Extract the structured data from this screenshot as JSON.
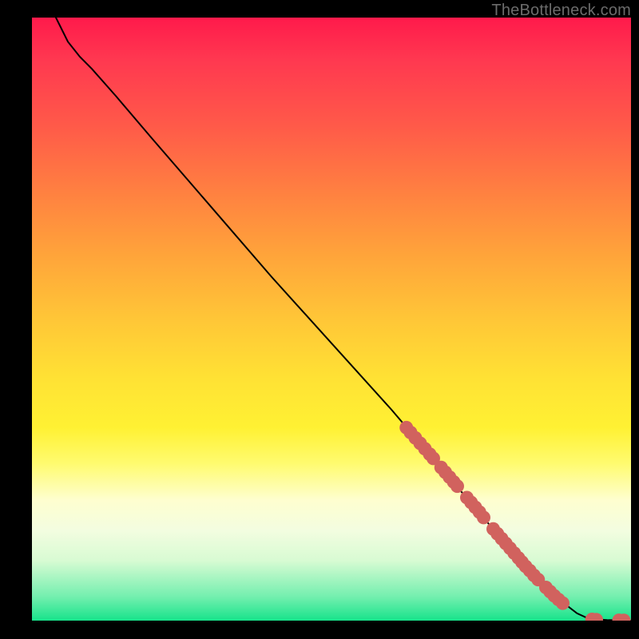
{
  "brand_label": "TheBottleneck.com",
  "colors": {
    "marker": "#d1625e",
    "curve": "#000000"
  },
  "chart_data": {
    "type": "line",
    "title": "",
    "xlabel": "",
    "ylabel": "",
    "xlim": [
      0,
      100
    ],
    "ylim": [
      0,
      100
    ],
    "grid": false,
    "legend": false,
    "notes": "Bottleneck-style curve: y drops from 100 at x≈4 to 0 near x≈93, then flat at 0. Markers cluster on the lower segment (roughly 62–100% x) where the curve approaches zero.",
    "curve": [
      {
        "x": 4,
        "y": 100
      },
      {
        "x": 6,
        "y": 96
      },
      {
        "x": 8,
        "y": 93.5
      },
      {
        "x": 10,
        "y": 91.5
      },
      {
        "x": 14,
        "y": 87
      },
      {
        "x": 20,
        "y": 80
      },
      {
        "x": 30,
        "y": 68.5
      },
      {
        "x": 40,
        "y": 57
      },
      {
        "x": 50,
        "y": 46
      },
      {
        "x": 60,
        "y": 35
      },
      {
        "x": 66,
        "y": 28
      },
      {
        "x": 72,
        "y": 21
      },
      {
        "x": 78,
        "y": 14
      },
      {
        "x": 84,
        "y": 7.5
      },
      {
        "x": 88,
        "y": 3.5
      },
      {
        "x": 91,
        "y": 1.2
      },
      {
        "x": 93,
        "y": 0.3
      },
      {
        "x": 96,
        "y": 0.1
      },
      {
        "x": 100,
        "y": 0
      }
    ],
    "markers": [
      {
        "x": 62.5,
        "y": 32
      },
      {
        "x": 63.2,
        "y": 31.2
      },
      {
        "x": 64.0,
        "y": 30.3
      },
      {
        "x": 64.8,
        "y": 29.4
      },
      {
        "x": 65.6,
        "y": 28.5
      },
      {
        "x": 66.4,
        "y": 27.6
      },
      {
        "x": 67.0,
        "y": 26.9
      },
      {
        "x": 68.3,
        "y": 25.4
      },
      {
        "x": 69.0,
        "y": 24.6
      },
      {
        "x": 69.7,
        "y": 23.8
      },
      {
        "x": 70.4,
        "y": 23.0
      },
      {
        "x": 71.0,
        "y": 22.3
      },
      {
        "x": 72.6,
        "y": 20.4
      },
      {
        "x": 73.3,
        "y": 19.6
      },
      {
        "x": 74.0,
        "y": 18.8
      },
      {
        "x": 74.7,
        "y": 18.0
      },
      {
        "x": 75.4,
        "y": 17.1
      },
      {
        "x": 77.0,
        "y": 15.2
      },
      {
        "x": 77.7,
        "y": 14.4
      },
      {
        "x": 78.4,
        "y": 13.6
      },
      {
        "x": 79.1,
        "y": 12.8
      },
      {
        "x": 79.8,
        "y": 12.0
      },
      {
        "x": 80.5,
        "y": 11.2
      },
      {
        "x": 81.2,
        "y": 10.4
      },
      {
        "x": 81.8,
        "y": 9.7
      },
      {
        "x": 82.4,
        "y": 9.0
      },
      {
        "x": 83.1,
        "y": 8.3
      },
      {
        "x": 83.8,
        "y": 7.5
      },
      {
        "x": 84.5,
        "y": 6.8
      },
      {
        "x": 85.8,
        "y": 5.5
      },
      {
        "x": 86.5,
        "y": 4.8
      },
      {
        "x": 87.2,
        "y": 4.1
      },
      {
        "x": 87.9,
        "y": 3.5
      },
      {
        "x": 88.6,
        "y": 2.9
      },
      {
        "x": 93.5,
        "y": 0.2
      },
      {
        "x": 94.2,
        "y": 0.15
      },
      {
        "x": 98.0,
        "y": 0.05
      },
      {
        "x": 98.8,
        "y": 0.03
      }
    ]
  }
}
